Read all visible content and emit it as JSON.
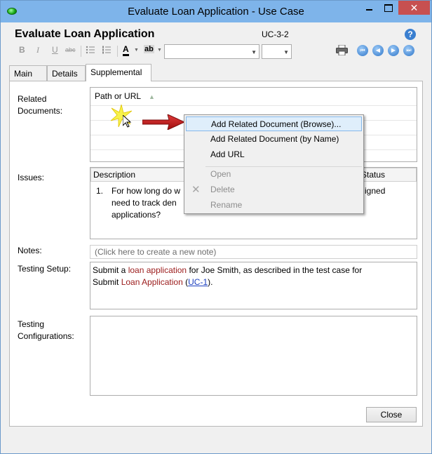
{
  "window": {
    "title": "Evaluate Loan Application - Use Case",
    "close_glyph": "✕"
  },
  "form": {
    "title": "Evaluate Loan Application",
    "id": "UC-3-2",
    "help_glyph": "?"
  },
  "toolbar": {
    "bold": "B",
    "italic": "I",
    "underline": "U",
    "strike": "abc",
    "font_color": "A",
    "highlight": "ab",
    "font_name_value": "",
    "font_size_value": ""
  },
  "nav_buttons": [
    {
      "name": "first-record",
      "glyph": "⏮"
    },
    {
      "name": "previous-record",
      "glyph": "◀"
    },
    {
      "name": "next-record",
      "glyph": "▶"
    },
    {
      "name": "last-record",
      "glyph": "⏭"
    }
  ],
  "tabs": [
    {
      "label": "Main"
    },
    {
      "label": "Details"
    },
    {
      "label": "Supplemental"
    }
  ],
  "supplemental": {
    "related_documents": {
      "label": "Related\nDocuments:",
      "column_header": "Path or URL"
    },
    "issues": {
      "label": "Issues:",
      "columns": [
        "Description",
        "Status"
      ],
      "rows": [
        {
          "number": "1.",
          "text_visible_left": "For how long do w",
          "text_line2_left": "need to track den",
          "text_line3": "applications?",
          "text_right": "igned"
        }
      ]
    },
    "notes": {
      "label": "Notes:",
      "placeholder": "(Click here to create a new note)"
    },
    "testing_setup": {
      "label": "Testing Setup:",
      "text_parts": [
        "Submit a ",
        "loan application",
        " for Joe Smith, as described in the test case for",
        "Submit ",
        "Loan Application",
        " (",
        "UC-1",
        ")."
      ]
    },
    "testing_configurations": {
      "label": "Testing\nConfigurations:",
      "value": ""
    }
  },
  "buttons": {
    "close": "Close"
  },
  "context_menu": {
    "items": [
      {
        "label": "Add Related Document (Browse)...",
        "state": "highlighted"
      },
      {
        "label": "Add Related Document (by Name)",
        "state": "normal"
      },
      {
        "label": "Add URL",
        "state": "normal"
      },
      {
        "label": "Open",
        "state": "disabled"
      },
      {
        "label": "Delete",
        "state": "disabled"
      },
      {
        "label": "Rename",
        "state": "disabled"
      }
    ]
  },
  "colors": {
    "titlebar": "#7eb4ea",
    "accent_blue": "#3a7fd0",
    "term_red": "#9b1b1b",
    "link_blue": "#1c3fbf",
    "menu_highlight": "#dfeefb"
  }
}
